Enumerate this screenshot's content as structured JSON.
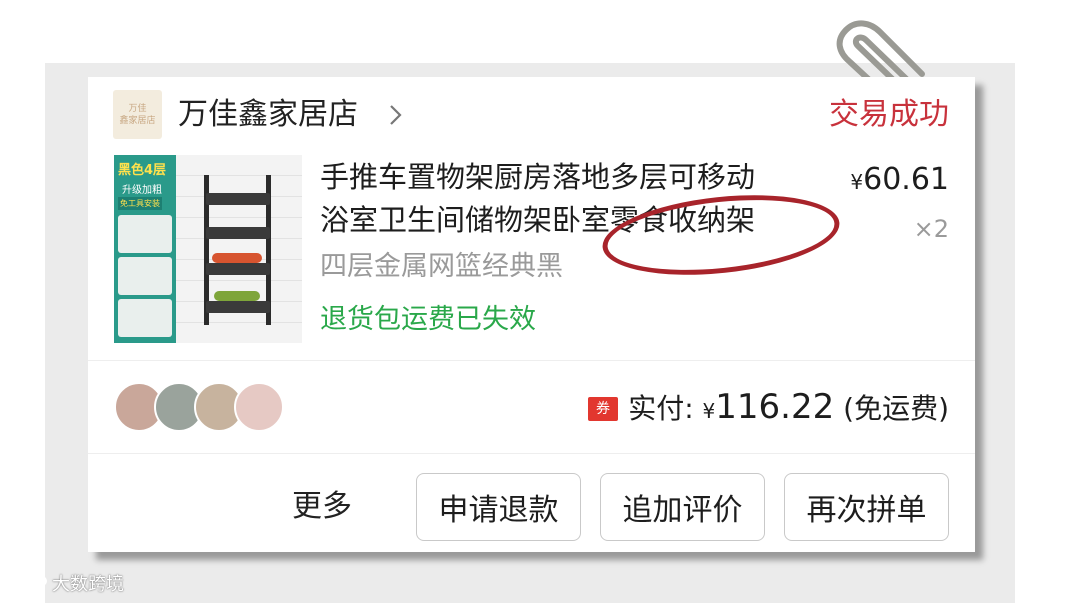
{
  "store": {
    "logo_text_line1": "万佳",
    "logo_text_line2": "鑫家居店",
    "name": "万佳鑫家居店",
    "status": "交易成功"
  },
  "product": {
    "title_line1": "手推车置物架厨房落地多层可移动",
    "title_line2": "浴室卫生间储物架卧室零食收纳架",
    "sku": "四层金属网篮经典黑",
    "return_note": "退货包运费已失效",
    "price_symbol": "¥",
    "price": "60.61",
    "quantity": "×2",
    "thumb_tag": "黑色4层",
    "thumb_sub": "升级加粗",
    "thumb_note": "免工具安装"
  },
  "payment": {
    "coupon_icon_text": "券",
    "label": "实付:",
    "symbol": "¥",
    "amount": "116.22",
    "note": "(免运费)"
  },
  "actions": {
    "more": "更多",
    "refund": "申请退款",
    "add_review": "追加评价",
    "reorder": "再次拼单"
  },
  "watermark": "大数跨境",
  "colors": {
    "status_red": "#c8323c",
    "return_green": "#2aa84a",
    "annotation_circle": "#a8242b"
  }
}
